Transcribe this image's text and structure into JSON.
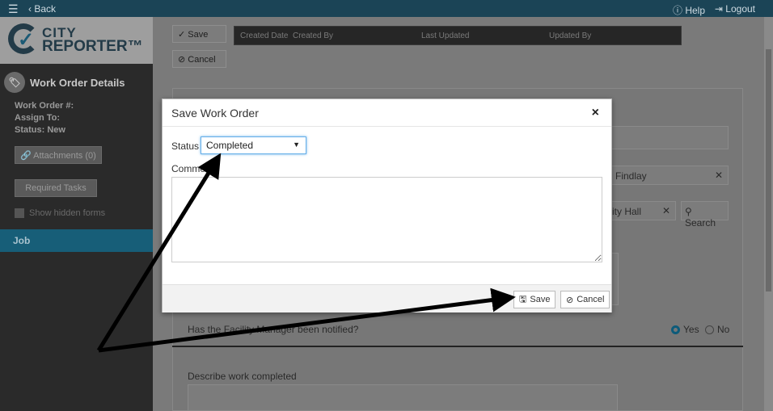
{
  "topbar": {
    "back_label": "Back",
    "help_label": "Help",
    "logout_label": "Logout"
  },
  "logo": {
    "line1": "CITY",
    "line2": "REPORTER™"
  },
  "sidebar": {
    "title": "Work Order Details",
    "work_order_label": "Work Order #:",
    "assign_label": "Assign To:",
    "status_label": "Status: New",
    "attachments_label": "Attachments (0)",
    "required_tasks_label": "Required Tasks",
    "show_hidden_label": "Show hidden forms",
    "job_label": "Job"
  },
  "toolbar": {
    "save_label": "Save",
    "cancel_label": "Cancel"
  },
  "header_table": {
    "columns": [
      "Created Date",
      "Created By",
      "Last Updated",
      "Updated By"
    ]
  },
  "background_form": {
    "location_value": "Findlay",
    "building_value": "ity Hall",
    "search_label": "Search",
    "facility_question": "Has the Facility Manager been notified?",
    "yes_label": "Yes",
    "no_label": "No",
    "yes_selected": true,
    "describe_label": "Describe work completed"
  },
  "modal": {
    "title": "Save Work Order",
    "status_label": "Status",
    "status_value": "Completed",
    "comment_label": "Comment",
    "comment_value": "",
    "save_label": "Save",
    "cancel_label": "Cancel"
  },
  "colors": {
    "topbar": "#1b4456",
    "accent": "#175e78",
    "focus": "#66afe9"
  }
}
